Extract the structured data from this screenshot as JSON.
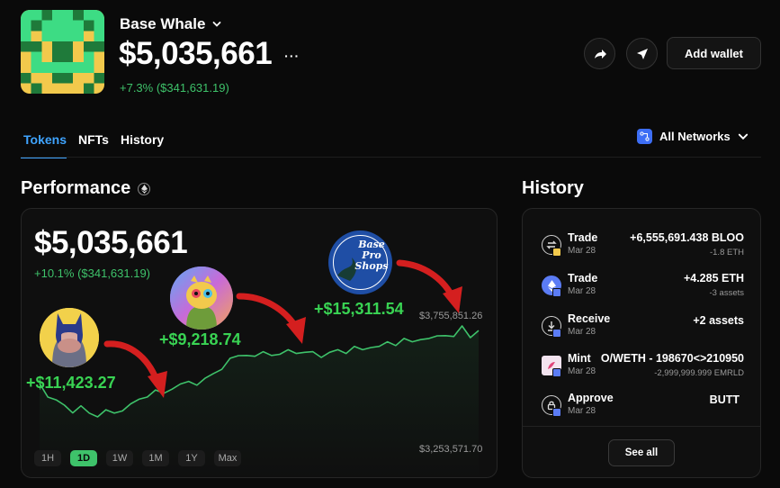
{
  "wallet": {
    "name": "Base Whale",
    "balance": "$5,035,661",
    "more": "···",
    "change": "+7.3% ($341,631.19)"
  },
  "actions": {
    "share_icon": "share-arrow-icon",
    "send_icon": "send-arrow-icon",
    "add_wallet": "Add wallet"
  },
  "tabs": [
    {
      "label": "Tokens",
      "active": true
    },
    {
      "label": "NFTs",
      "active": false
    },
    {
      "label": "History",
      "active": false
    }
  ],
  "networks": {
    "label": "All Networks"
  },
  "performance": {
    "title": "Performance",
    "balance": "$5,035,661",
    "change": "+10.1% ($341,631.19)",
    "y_max_label": "$3,755,851.26",
    "y_min_label": "$3,253,571.70",
    "ranges": [
      "1H",
      "1D",
      "1W",
      "1M",
      "1Y",
      "Max"
    ],
    "active_range": "1D",
    "gains": [
      "+$11,423.27",
      "+$9,218.74",
      "+$15,311.54"
    ],
    "badge_text": [
      "Base",
      "Pro",
      "Shops"
    ]
  },
  "chart_data": {
    "type": "area",
    "color": "#3ec26a",
    "y_range": [
      3253571.7,
      3755851.26
    ],
    "points_count": 54
  },
  "history": {
    "title": "History",
    "items": [
      {
        "type": "Trade",
        "date": "Mar 28",
        "amount": "+6,555,691.438 BLOO",
        "detail": "-1.8 ETH",
        "icon": "swap-icon"
      },
      {
        "type": "Trade",
        "date": "Mar 28",
        "amount": "+4.285 ETH",
        "detail": "-3 assets",
        "icon": "eth-icon"
      },
      {
        "type": "Receive",
        "date": "Mar 28",
        "amount": "+2 assets",
        "detail": "",
        "icon": "receive-icon"
      },
      {
        "type": "Mint",
        "date": "Mar 28",
        "amount": "O/WETH - 198670<>210950",
        "detail": "-2,999,999.999 EMRLD",
        "icon": "mint-icon"
      },
      {
        "type": "Approve",
        "date": "Mar 28",
        "amount": "BUTT",
        "detail": "",
        "icon": "lock-icon"
      }
    ],
    "see_all": "See all"
  }
}
